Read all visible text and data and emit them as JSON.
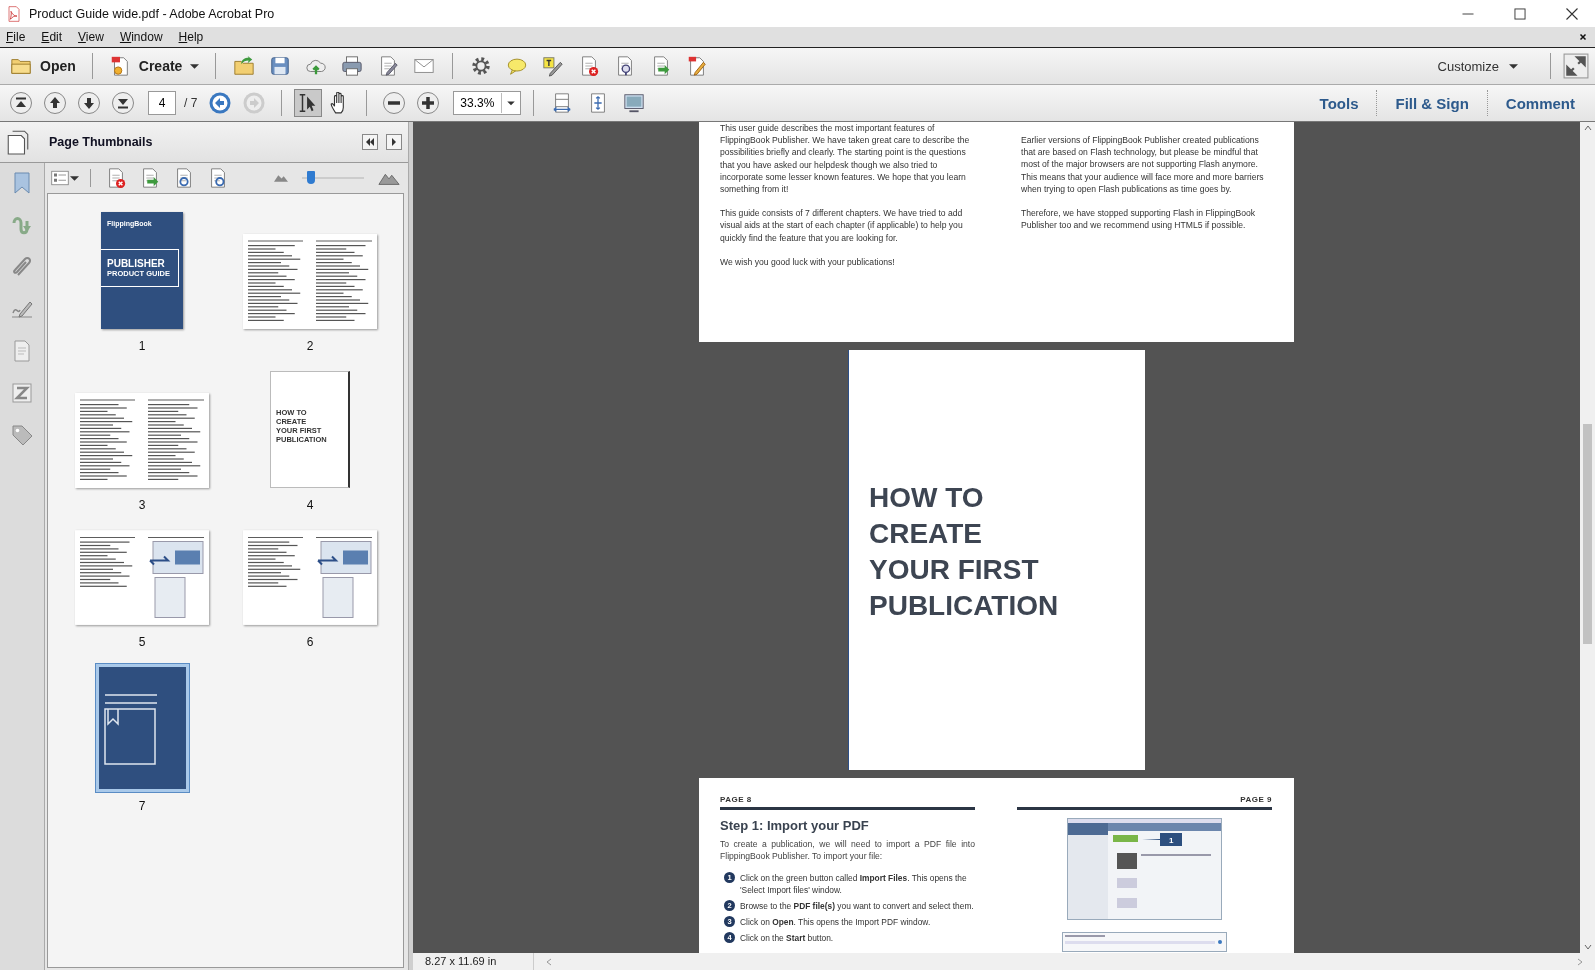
{
  "window": {
    "title": "Product Guide wide.pdf - Adobe Acrobat Pro"
  },
  "menu": [
    "File",
    "Edit",
    "View",
    "Window",
    "Help"
  ],
  "toolbar": {
    "open_label": "Open",
    "create_label": "Create",
    "customize_label": "Customize"
  },
  "navigation": {
    "page": "4",
    "total": "/ 7",
    "forward_disabled": true,
    "zoom": "33.3%",
    "tools": [
      {
        "kind": "select",
        "selected": true
      },
      {
        "kind": "hand",
        "selected": false
      }
    ],
    "panes": [
      "Tools",
      "Fill & Sign",
      "Comment"
    ]
  },
  "thumbnails_panel": {
    "title": "Page Thumbnails",
    "zoom_slider": {
      "level": 0.1
    },
    "thumbnails": [
      {
        "label": "1",
        "kind": "cover",
        "selected": false,
        "brand": "FlippingBook",
        "title": "PUBLISHER",
        "subtitle": "PRODUCT GUIDE"
      },
      {
        "label": "2",
        "kind": "text",
        "selected": false
      },
      {
        "label": "3",
        "kind": "text",
        "selected": false
      },
      {
        "label": "4",
        "kind": "chapter",
        "selected": false,
        "title_lines": [
          "HOW TO",
          "CREATE",
          "YOUR FIRST",
          "PUBLICATION"
        ]
      },
      {
        "label": "5",
        "kind": "screens",
        "selected": false
      },
      {
        "label": "6",
        "kind": "screens",
        "selected": false
      },
      {
        "label": "7",
        "kind": "bookmark",
        "selected": true
      }
    ]
  },
  "document": {
    "top_spread": {
      "left": [
        "This user guide describes the most important features of FlippingBook Publisher. We have taken great care to describe the possibilities briefly and clearly. The starting point is the questions that you have asked our helpdesk though we also tried to incorporate some lesser known features. We hope that you learn something from it!",
        "This guide consists of 7 different chapters. We have tried to add visual aids at the start of each chapter (if applicable) to help you quickly find the feature that you are looking for.",
        "We wish you good luck with your publications!"
      ],
      "right": [
        "Earlier versions of FlippingBook Publisher created publications that are based on Flash technology, but please be mindful that most of the major browsers are not supporting Flash anymore. This means that your audience will face more and more barriers when trying to open Flash publications as time goes by.",
        "Therefore, we have stopped supporting Flash in FlippingBook Publisher too and we recommend using HTML5 if possible."
      ]
    },
    "chapter_page": {
      "title_lines": [
        "HOW TO",
        "CREATE",
        "YOUR FIRST",
        "PUBLICATION"
      ]
    },
    "bottom_spread": {
      "left_header": "PAGE 8",
      "right_header": "PAGE 9",
      "heading": "Step 1: Import your PDF",
      "intro": "To create a publication, we will need to import a PDF file into FlippingBook Publisher. To import your file:",
      "steps": [
        {
          "number": "1",
          "text": "Click on the green button called **Import Files**. This opens the 'Select Import files' window."
        },
        {
          "number": "2",
          "text": "Browse to the **PDF file(s)** you want to convert and select them."
        },
        {
          "number": "3",
          "text": "Click on **Open**. This opens the Import PDF window."
        },
        {
          "number": "4",
          "text": "Click on the **Start** button."
        }
      ],
      "callout": "1"
    }
  },
  "status_bar": {
    "page_size": "8.27 x 11.69 in"
  }
}
